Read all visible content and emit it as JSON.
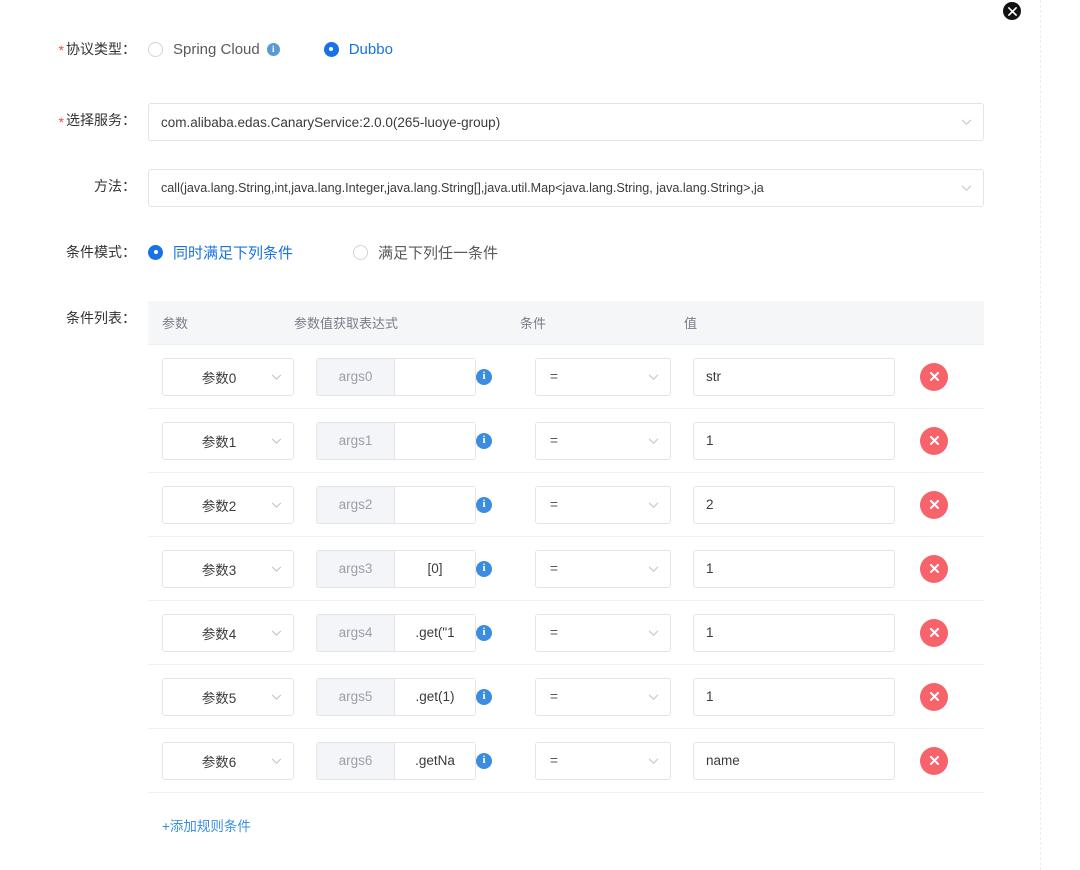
{
  "window": {
    "close_label": "✕"
  },
  "form": {
    "protocol": {
      "label": "协议类型：",
      "required": true,
      "options": [
        {
          "label": "Spring Cloud",
          "checked": false,
          "has_info": true
        },
        {
          "label": "Dubbo",
          "checked": true,
          "has_info": false
        }
      ]
    },
    "service": {
      "label": "选择服务：",
      "required": true,
      "value": "com.alibaba.edas.CanaryService:2.0.0(265-luoye-group)"
    },
    "method": {
      "label": "方法：",
      "required": false,
      "value": "call(java.lang.String,int,java.lang.Integer,java.lang.String[],java.util.Map<java.lang.String, java.lang.String>,ja"
    },
    "condition_mode": {
      "label": "条件模式：",
      "options": [
        {
          "label": "同时满足下列条件",
          "checked": true
        },
        {
          "label": "满足下列任一条件",
          "checked": false
        }
      ]
    },
    "condition_list": {
      "label": "条件列表：",
      "columns": [
        "参数",
        "参数值获取表达式",
        "条件",
        "值"
      ],
      "rows": [
        {
          "param": "参数0",
          "arg_prefix": "args0",
          "expression": "",
          "operator": "=",
          "value": "str"
        },
        {
          "param": "参数1",
          "arg_prefix": "args1",
          "expression": "",
          "operator": "=",
          "value": "1"
        },
        {
          "param": "参数2",
          "arg_prefix": "args2",
          "expression": "",
          "operator": "=",
          "value": "2"
        },
        {
          "param": "参数3",
          "arg_prefix": "args3",
          "expression": "[0]",
          "operator": "=",
          "value": "1"
        },
        {
          "param": "参数4",
          "arg_prefix": "args4",
          "expression": ".get(\"1",
          "operator": "=",
          "value": "1"
        },
        {
          "param": "参数5",
          "arg_prefix": "args5",
          "expression": ".get(1)",
          "operator": "=",
          "value": "1"
        },
        {
          "param": "参数6",
          "arg_prefix": "args6",
          "expression": ".getNa",
          "operator": "=",
          "value": "name"
        }
      ],
      "add_label": "+添加规则条件",
      "info_icon": "info-icon",
      "delete_icon": "delete-icon"
    }
  },
  "colors": {
    "accent": "#1872e6",
    "link": "#3a8ee6",
    "danger": "#f7636b",
    "required": "#e6504d",
    "info": "#5b9bd5",
    "header_bg": "#f5f6f8",
    "border": "#e3e4e8"
  }
}
